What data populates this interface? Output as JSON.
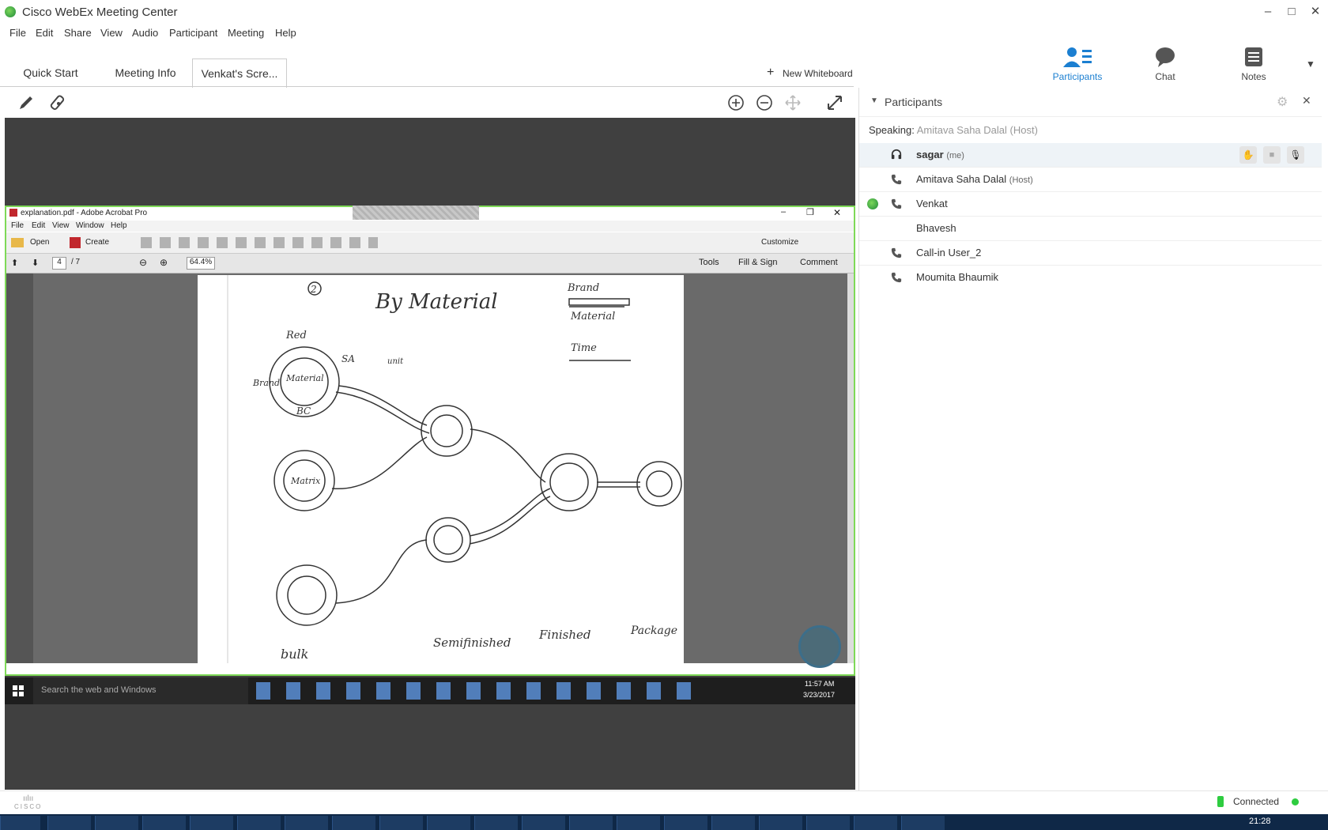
{
  "window": {
    "title": "Cisco WebEx Meeting Center",
    "controls": [
      "–",
      "□",
      "✕"
    ]
  },
  "menu": [
    "File",
    "Edit",
    "Share",
    "View",
    "Audio",
    "Participant",
    "Meeting",
    "Help"
  ],
  "tabs": [
    {
      "label": "Quick Start",
      "active": false
    },
    {
      "label": "Meeting Info",
      "active": false
    },
    {
      "label": "Venkat's Scre...",
      "active": true
    }
  ],
  "new_whiteboard": "New Whiteboard",
  "panel_buttons": [
    {
      "label": "Participants",
      "icon": "participants-icon",
      "active": true
    },
    {
      "label": "Chat",
      "icon": "chat-icon",
      "active": false
    },
    {
      "label": "Notes",
      "icon": "notes-icon",
      "active": false
    }
  ],
  "participants_panel": {
    "title": "Participants",
    "speaking_label": "Speaking:",
    "speaking_name": "Amitava Saha Dalal (Host)",
    "participants": [
      {
        "name": "sagar",
        "suffix": "(me)",
        "icon": "headset-icon",
        "selected": true
      },
      {
        "name": "Amitava Saha Dalal",
        "suffix": "(Host)",
        "icon": "phone-icon",
        "selected": false
      },
      {
        "name": "Venkat",
        "suffix": "",
        "icon": "phone-icon",
        "presenter": true,
        "selected": false
      },
      {
        "name": "Bhavesh",
        "suffix": "",
        "icon": "",
        "selected": false
      },
      {
        "name": "Call-in User_2",
        "suffix": "",
        "icon": "phone-icon",
        "selected": false
      },
      {
        "name": "Moumita Bhaumik",
        "suffix": "",
        "icon": "phone-icon",
        "selected": false
      }
    ]
  },
  "acrobat": {
    "title": "explanation.pdf - Adobe Acrobat Pro",
    "menu": [
      "File",
      "Edit",
      "View",
      "Window",
      "Help"
    ],
    "open_label": "Open",
    "create_label": "Create",
    "customize_label": "Customize",
    "page_current": "4",
    "page_total": "/ 7",
    "zoom": "64.4%",
    "tools_label": "Tools",
    "fill_sign_label": "Fill & Sign",
    "comment_label": "Comment"
  },
  "sketch_text": {
    "page_number": "2",
    "title": "By Material",
    "legend_brand": "Brand",
    "legend_material": "Material",
    "legend_time": "Time",
    "node_material": "Material",
    "label_red": "Red",
    "label_brand": "Brand",
    "label_sa": "SA",
    "label_unit": "unit",
    "label_bc": "BC",
    "node_matrix": "Matrix",
    "label_bulk": "bulk",
    "label_semifinished": "Semifinished",
    "label_finished": "Finished",
    "label_package": "Package"
  },
  "win_taskbar": {
    "search_placeholder": "Search the web and Windows",
    "time": "11:57 AM",
    "date": "3/23/2017"
  },
  "status": {
    "connection": "Connected",
    "connection_color": "#2ecc40",
    "logo_text": "CISCO"
  },
  "os_taskbar": {
    "time": "21:28"
  }
}
